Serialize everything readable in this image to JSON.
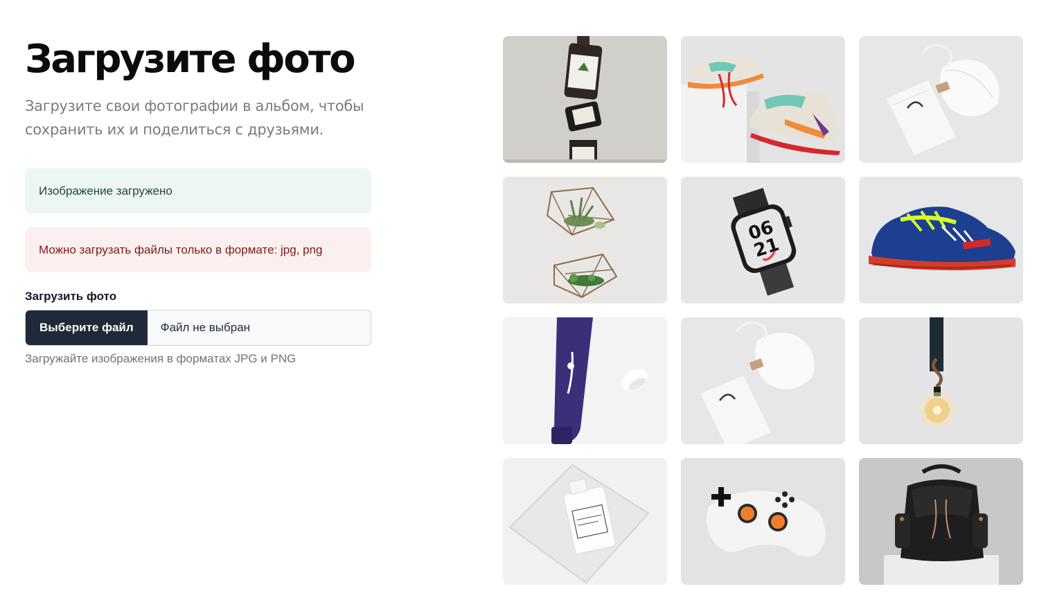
{
  "header": {
    "title": "Загрузите фото",
    "subtitle": "Загрузите свои фотографии в альбом, чтобы сохранить их и поделиться с друзьями."
  },
  "alerts": {
    "success": "Изображение загружено",
    "error": "Можно загрузать файлы только в формате: jpg, png"
  },
  "upload": {
    "label": "Загрузить фото",
    "button_label": "Выберите файл",
    "file_status": "Файл не выбран",
    "hint": "Загружайте изображения в форматах JPG и PNG"
  },
  "gallery": {
    "photos": [
      {
        "subject": "cosmetic-bottles-stack",
        "background": "#d4d2cd"
      },
      {
        "subject": "sneakers-on-box",
        "background": "#e6e6e6"
      },
      {
        "subject": "white-pouch-and-bag",
        "background": "#e8e8ea"
      },
      {
        "subject": "geometric-terrariums",
        "background": "#e9e8e6"
      },
      {
        "subject": "smartwatch",
        "background": "#e6e6e8"
      },
      {
        "subject": "blue-football-boot",
        "background": "#e7e7e9"
      },
      {
        "subject": "purple-cream-tube",
        "background": "#f4f4f4"
      },
      {
        "subject": "white-pouch-and-bag",
        "background": "#e8e8ea"
      },
      {
        "subject": "hanging-light-bulb",
        "background": "#e4e4e6"
      },
      {
        "subject": "bottle-in-glass-cube",
        "background": "#f0f0f0"
      },
      {
        "subject": "game-controller",
        "background": "#e4e4e4"
      },
      {
        "subject": "black-backpack",
        "background": "#c9c9c9"
      }
    ],
    "watch_face": [
      "06",
      "21"
    ]
  }
}
